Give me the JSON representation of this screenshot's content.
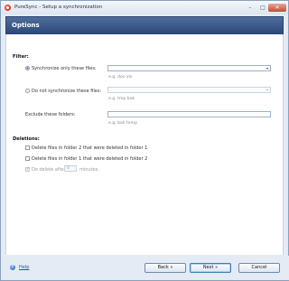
{
  "window": {
    "title": "PureSync - Setup a synchronization",
    "minimize_symbol": "–",
    "maximize_symbol": "□",
    "close_symbol": "✕"
  },
  "header": {
    "title": "Options"
  },
  "filter": {
    "section_label": "Filter:",
    "sync_only": {
      "label": "Synchronize only these files:",
      "selected": true,
      "value": "",
      "hint": "e.g. doc xls"
    },
    "do_not_sync": {
      "label": "Do not synchronize these files:",
      "selected": false,
      "value": "",
      "hint": "e.g. tmp bak"
    },
    "exclude_folders": {
      "label": "Exclude these folders:",
      "value": "",
      "hint": "e.g. bak temp"
    }
  },
  "deletions": {
    "section_label": "Deletions:",
    "delete_in_folder2": {
      "label": "Delete files in folder 2 that were deleted in folder 1",
      "checked": false
    },
    "delete_in_folder1": {
      "label": "Delete files in folder 1 that were deleted in folder 2",
      "checked": false
    },
    "do_delete_after": {
      "label": "Do delete after",
      "checked": true,
      "enabled": false,
      "value": "0",
      "unit": "minutes."
    }
  },
  "footer": {
    "help_label": "Help",
    "help_icon": "help-icon",
    "back_label": "Back «",
    "next_label": "Next »",
    "cancel_label": "Cancel"
  },
  "icons": {
    "dropdown": "▾"
  },
  "colors": {
    "header_bg": "#3b5a8c",
    "window_bg": "#e4ebf4",
    "radio_selected": "#2a6bd1",
    "link": "#1d58b8"
  }
}
